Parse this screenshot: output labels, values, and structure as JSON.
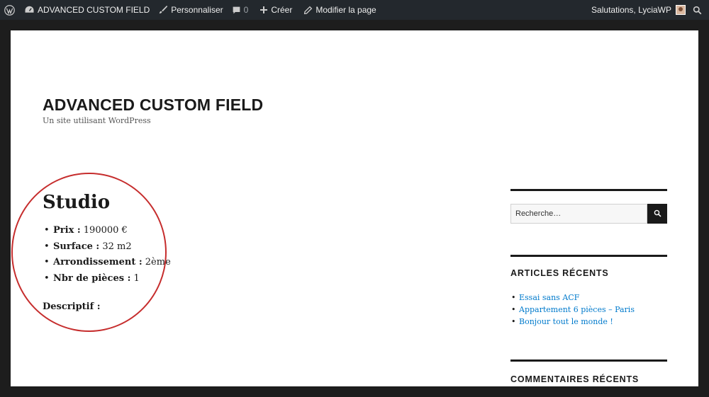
{
  "adminbar": {
    "wp_logo": "wordpress-icon",
    "site_name": "ADVANCED CUSTOM FIELD",
    "customize": "Personnaliser",
    "comments_count": "0",
    "new": "Créer",
    "edit_page": "Modifier la page",
    "greeting": "Salutations, LyciaWP"
  },
  "site": {
    "title": "ADVANCED CUSTOM FIELD",
    "description": "Un site utilisant WordPress"
  },
  "entry": {
    "title": "Studio",
    "fields": [
      {
        "label": "Prix :",
        "value": " 190000 €"
      },
      {
        "label": "Surface :",
        "value": " 32 m2"
      },
      {
        "label": "Arrondissement :",
        "value": " 2ème"
      },
      {
        "label": "Nbr de pièces :",
        "value": " 1"
      }
    ],
    "descriptif_label": "Descriptif :"
  },
  "sidebar": {
    "search_placeholder": "Recherche…",
    "recent_posts_title": "ARTICLES RÉCENTS",
    "recent_posts": [
      "Essai sans ACF",
      "Appartement 6 pièces – Paris",
      "Bonjour tout le monde !"
    ],
    "recent_comments_title": "COMMENTAIRES RÉCENTS"
  },
  "colors": {
    "adminbar_bg": "#23282d",
    "link": "#007acc",
    "highlight_circle": "#c62d2d"
  }
}
